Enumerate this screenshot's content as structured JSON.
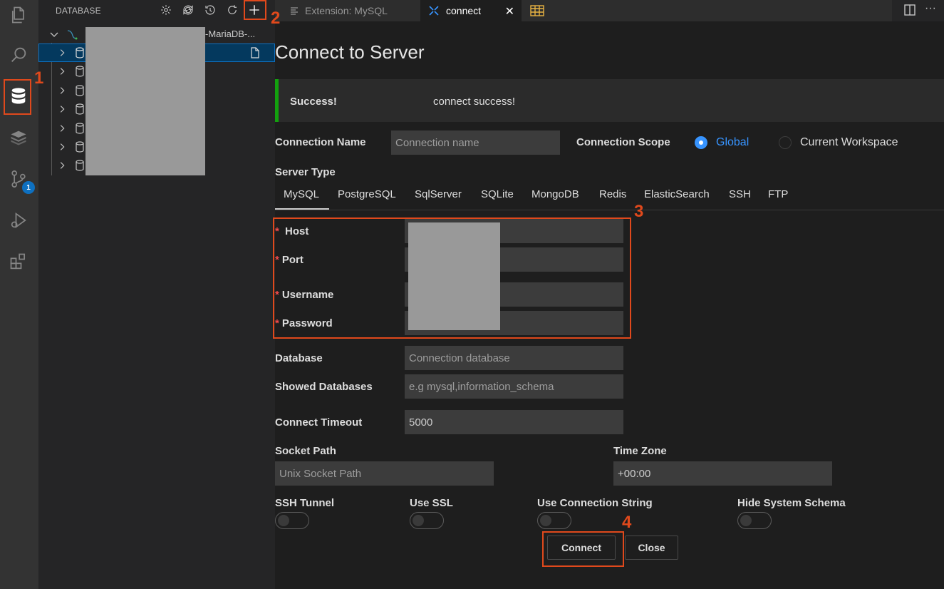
{
  "activity_bar": {
    "items": [
      "explorer-icon",
      "search-icon",
      "database-icon",
      "redis-stack-icon",
      "source-control-icon",
      "run-debug-icon",
      "extensions-icon"
    ],
    "source_control_badge": "1"
  },
  "sidebar": {
    "title": "DATABASE",
    "actions": [
      "settings-icon",
      "sync-icon",
      "history-icon",
      "refresh-icon",
      "add-connection-icon"
    ],
    "root_label": "-MariaDB-...",
    "row_count": 7
  },
  "tabs": [
    {
      "label": "Extension: MySQL",
      "active": false
    },
    {
      "label": "connect",
      "active": true
    },
    {
      "label": "",
      "active": false
    }
  ],
  "form": {
    "title": "Connect to Server",
    "alert": {
      "title": "Success!",
      "message": "connect success!"
    },
    "connection_name_label": "Connection Name",
    "connection_name_placeholder": "Connection name",
    "connection_scope_label": "Connection Scope",
    "scope_global": "Global",
    "scope_workspace": "Current Workspace",
    "server_type_label": "Server Type",
    "server_types": [
      "MySQL",
      "PostgreSQL",
      "SqlServer",
      "SQLite",
      "MongoDB",
      "Redis",
      "ElasticSearch",
      "SSH",
      "FTP"
    ],
    "selected_server_type": "MySQL",
    "host_label": "Host",
    "port_label": "Port",
    "username_label": "Username",
    "password_label": "Password",
    "database_label": "Database",
    "database_placeholder": "Connection database",
    "showed_databases_label": "Showed Databases",
    "showed_databases_placeholder": "e.g mysql,information_schema",
    "connect_timeout_label": "Connect Timeout",
    "connect_timeout_value": "5000",
    "socket_path_label": "Socket Path",
    "socket_path_placeholder": "Unix Socket Path",
    "time_zone_label": "Time Zone",
    "time_zone_value": "+00:00",
    "ssh_tunnel_label": "SSH Tunnel",
    "use_ssl_label": "Use SSL",
    "use_connection_string_label": "Use Connection String",
    "hide_system_schema_label": "Hide System Schema",
    "connect_button": "Connect",
    "close_button": "Close"
  },
  "annotations": [
    "1",
    "2",
    "3",
    "4"
  ],
  "colors": {
    "annotation": "#e0491c",
    "accent": "#3794ff",
    "success": "#13a10e",
    "selection": "#04395e"
  }
}
